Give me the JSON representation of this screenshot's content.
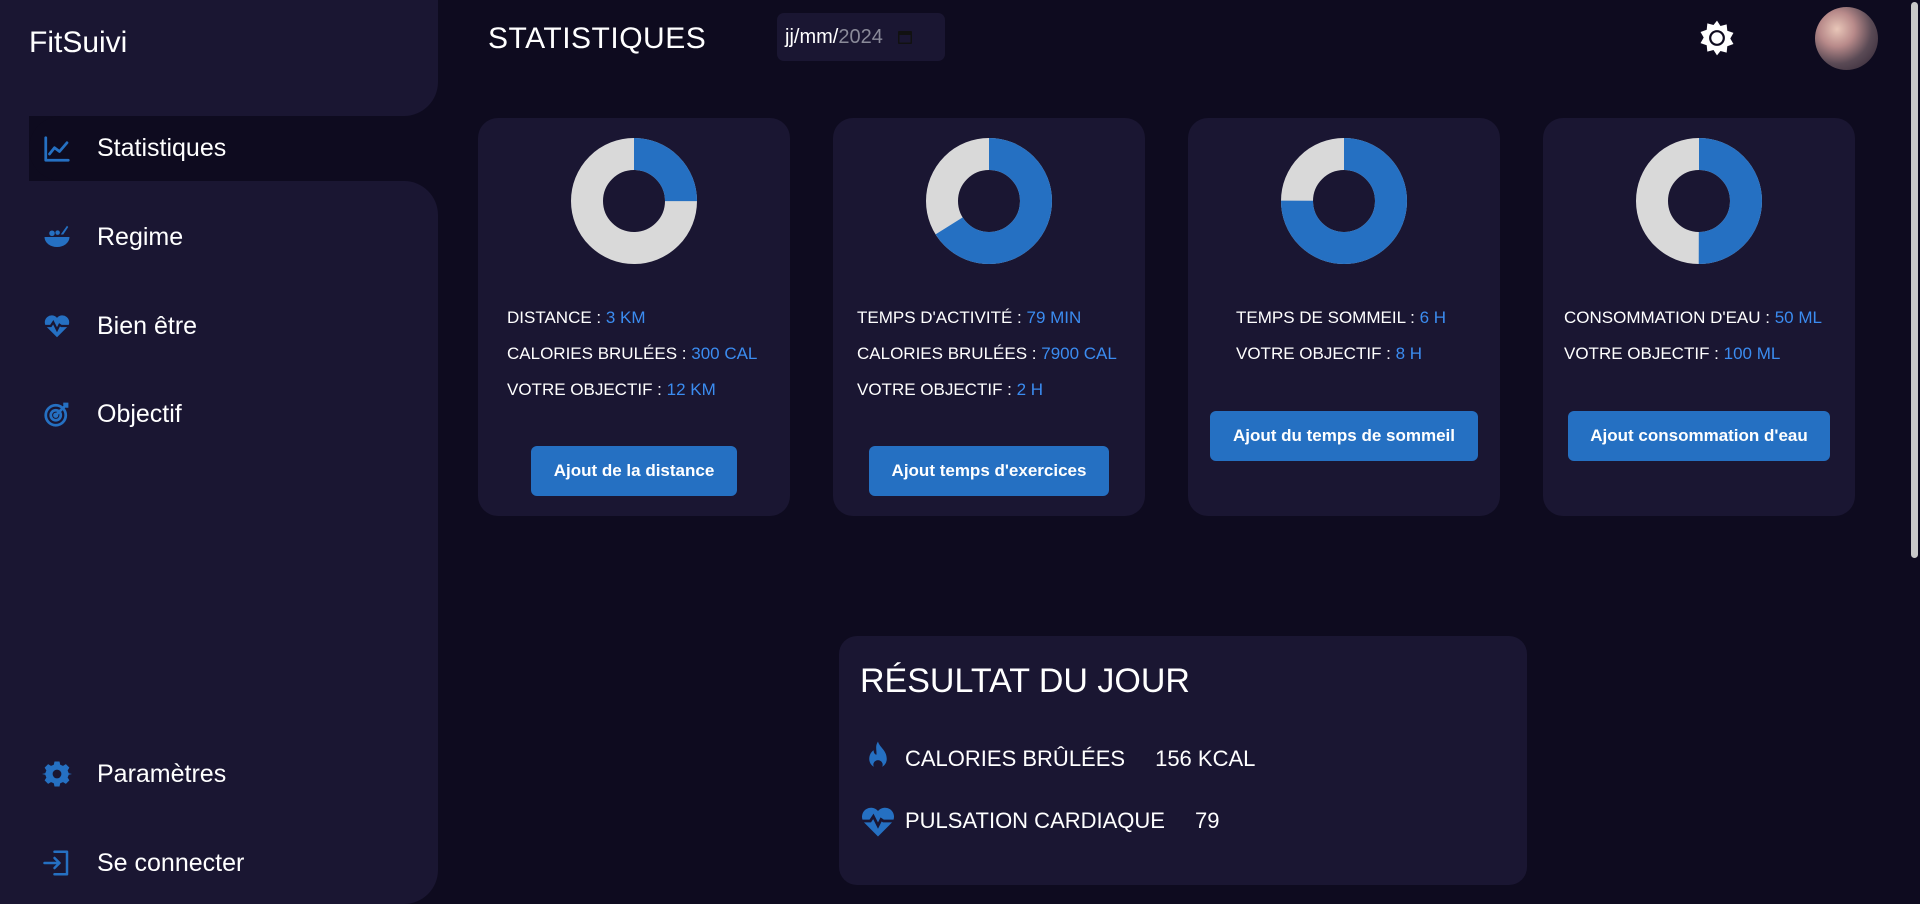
{
  "app": {
    "brand": "FitSuivi"
  },
  "nav": {
    "items": [
      {
        "label": "Statistiques",
        "icon": "chart-line-icon",
        "active": true
      },
      {
        "label": "Regime",
        "icon": "bowl-food-icon"
      },
      {
        "label": "Bien être",
        "icon": "heart-pulse-icon"
      },
      {
        "label": "Objectif",
        "icon": "target-icon"
      }
    ],
    "bottom": [
      {
        "label": "Paramètres",
        "icon": "gear-icon"
      },
      {
        "label": "Se connecter",
        "icon": "login-icon"
      }
    ]
  },
  "header": {
    "title": "STATISTIQUES",
    "date_day_month": "jj/mm/",
    "date_year": "2024"
  },
  "colors": {
    "accent": "#2570c2",
    "value": "#3b8cf0",
    "donut_rest": "#d9d9d9",
    "bg": "#0e0b1f",
    "panel": "#1a1632"
  },
  "cards": [
    {
      "progress": 0.25,
      "lines": [
        {
          "label": "DISTANCE : ",
          "value": "3 KM"
        },
        {
          "label": "CALORIES BRULÉES : ",
          "value": "300 CAL"
        },
        {
          "label": "VOTRE OBJECTIF : ",
          "value": "12 KM"
        }
      ],
      "button": "Ajout de la distance"
    },
    {
      "progress": 0.66,
      "lines": [
        {
          "label": "TEMPS D'ACTIVITÉ : ",
          "value": "79 MIN"
        },
        {
          "label": "CALORIES BRULÉES : ",
          "value": "7900 CAL"
        },
        {
          "label": "VOTRE OBJECTIF : ",
          "value": "2 H"
        }
      ],
      "button": "Ajout temps d'exercices"
    },
    {
      "progress": 0.75,
      "lines": [
        {
          "label": "TEMPS DE SOMMEIL : ",
          "value": "6 H"
        },
        {
          "label": "VOTRE OBJECTIF : ",
          "value": "8 H"
        }
      ],
      "button": "Ajout du temps de sommeil"
    },
    {
      "progress": 0.5,
      "lines": [
        {
          "label": "CONSOMMATION D'EAU : ",
          "value": "50 ML"
        },
        {
          "label": "VOTRE OBJECTIF : ",
          "value": "100 ML"
        }
      ],
      "button": "Ajout consommation d'eau"
    }
  ],
  "result": {
    "title": "RÉSULTAT DU JOUR",
    "rows": [
      {
        "label": "CALORIES BRÛLÉES",
        "value": "156 KCAL",
        "icon": "flame-icon"
      },
      {
        "label": "PULSATION CARDIAQUE",
        "value": "79",
        "icon": "heart-pulse-icon"
      }
    ]
  }
}
